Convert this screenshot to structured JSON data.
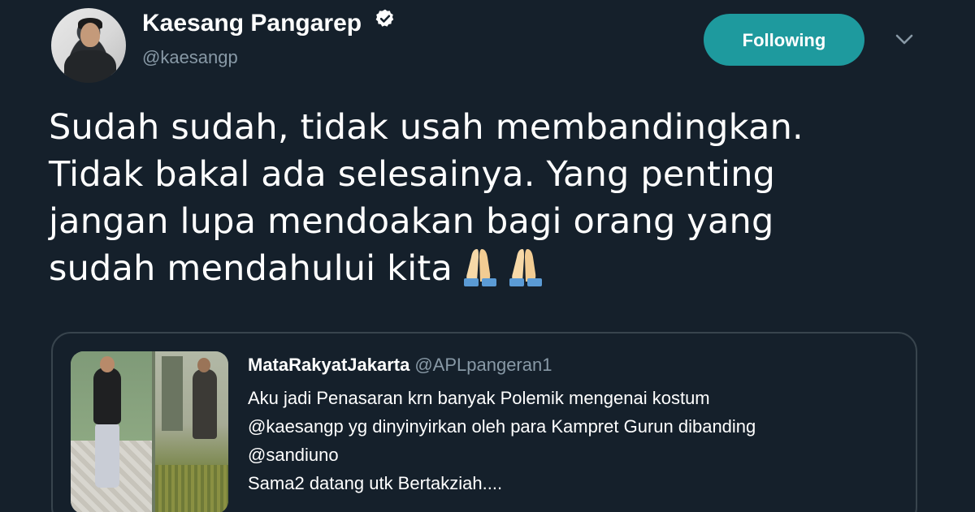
{
  "author": {
    "display_name": "Kaesang Pangarep",
    "handle": "@kaesangp",
    "verified": true
  },
  "follow_button": {
    "label": "Following"
  },
  "tweet": {
    "lines": [
      "Sudah sudah, tidak usah membandingkan.",
      "Tidak bakal ada selesainya. Yang penting",
      "jangan lupa mendoakan bagi orang yang",
      "sudah mendahului kita"
    ],
    "emoji": [
      "folded-hands",
      "folded-hands"
    ]
  },
  "quoted_tweet": {
    "name": "MataRakyatJakarta",
    "handle": "@APLpangeran1",
    "lines": [
      "Aku jadi Penasaran krn banyak Polemik mengenai kostum",
      "@kaesangp yg dinyinyirkan oleh para Kampret Gurun dibanding",
      "@sandiuno",
      "Sama2 datang utk Bertakziah...."
    ]
  },
  "colors": {
    "background": "#15202b",
    "accent": "#1e9a9e",
    "secondary_text": "#8899a6",
    "border": "#38444d"
  },
  "icons": {
    "verified": "verified-badge-icon",
    "caret": "chevron-down-icon",
    "emoji": "folded-hands-emoji-icon"
  }
}
